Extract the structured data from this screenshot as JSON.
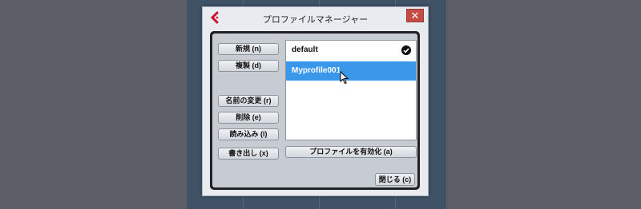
{
  "window": {
    "title": "プロファイルマネージャー",
    "close_symbol": "✕",
    "app_icon": "cubase-logo-icon"
  },
  "buttons": {
    "new": "新規 (n)",
    "duplicate": "複製 (d)",
    "rename": "名前の変更 (r)",
    "delete": "削除 (e)",
    "import": "読み込み (l)",
    "export": "書き出し (x)",
    "activate": "プロファイルを有効化 (a)",
    "close": "閉じる (c)"
  },
  "profiles": [
    {
      "name": "default",
      "active": true,
      "selected": false
    },
    {
      "name": "Myprofile001",
      "active": false,
      "selected": true
    }
  ],
  "colors": {
    "selection": "#3a97ea",
    "close_button": "#c54b47",
    "accent": "#c8102e"
  }
}
